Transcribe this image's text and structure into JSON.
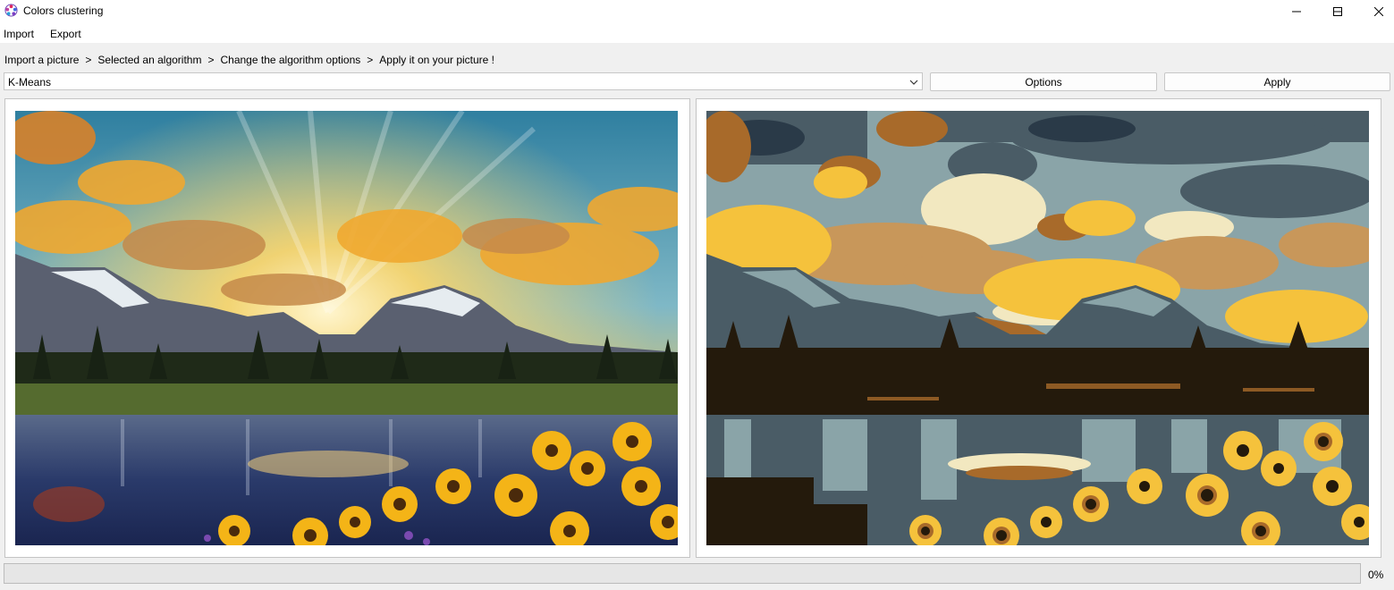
{
  "window": {
    "title": "Colors clustering",
    "app_icon": "color-wheel-icon",
    "controls": [
      "minimize-icon",
      "maximize-icon",
      "close-icon"
    ]
  },
  "menu": {
    "items": [
      {
        "label": "Import"
      },
      {
        "label": "Export"
      }
    ]
  },
  "breadcrumb": {
    "steps": [
      "Import a picture",
      "Selected an algorithm",
      "Change the algorithm options",
      "Apply it on your picture !"
    ],
    "separator": ">"
  },
  "toolbar": {
    "algorithm": "K-Means",
    "options_label": "Options",
    "apply_label": "Apply"
  },
  "progress": {
    "value": 0,
    "text": "0%",
    "fill_color": "#06b025"
  },
  "colors": {
    "window_bg": "#f0f0f0",
    "cluster_palette": [
      "#241a0c",
      "#4a5c66",
      "#8aa4a8",
      "#f5c23c",
      "#c8975a",
      "#f2e8c0",
      "#a86a2a"
    ]
  }
}
